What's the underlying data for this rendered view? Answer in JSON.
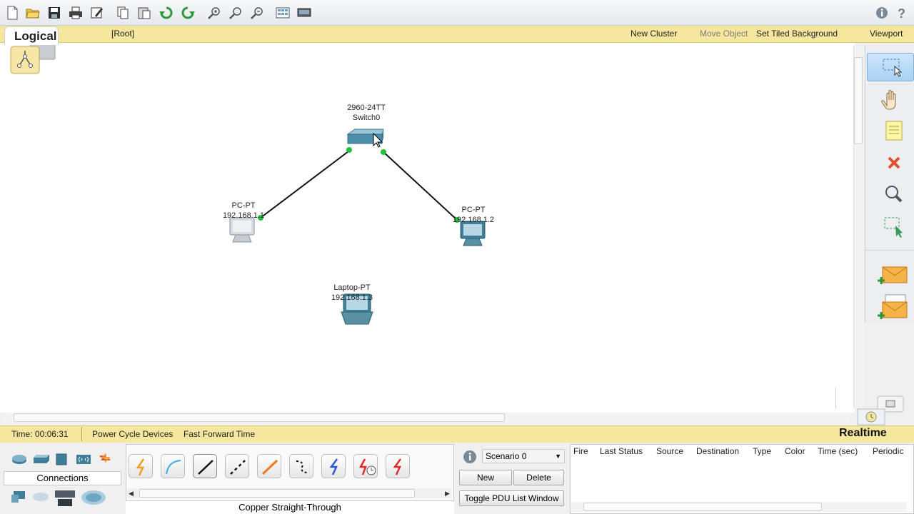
{
  "toolbar": {
    "icons": [
      "new-file-icon",
      "open-folder-icon",
      "save-icon",
      "print-icon",
      "activity-wizard-icon",
      "copy-icon",
      "paste-icon",
      "undo-icon",
      "redo-icon",
      "zoom-in-icon",
      "zoom-reset-icon",
      "zoom-out-icon",
      "palette-icon",
      "custom-device-icon"
    ],
    "help_icons": [
      "info-icon",
      "help-icon"
    ]
  },
  "logical_bar": {
    "tab_label": "Logical",
    "root_label": "[Root]",
    "new_cluster": "New Cluster",
    "move_object": "Move Object",
    "set_tiled_background": "Set Tiled Background",
    "viewport": "Viewport"
  },
  "devices": [
    {
      "name": "switch0",
      "model": "2960-24TT",
      "label": "Switch0"
    },
    {
      "name": "pc0",
      "model": "PC-PT",
      "ip": "192.168.1.1"
    },
    {
      "name": "pc1",
      "model": "PC-PT",
      "ip": "192.168.1.2"
    },
    {
      "name": "laptop0",
      "model": "Laptop-PT",
      "ip": "192.168.1.3"
    }
  ],
  "status": {
    "time": "Time: 00:06:31",
    "power_cycle": "Power Cycle Devices",
    "fast_forward": "Fast Forward Time",
    "mode": "Realtime"
  },
  "bottom": {
    "connections_label": "Connections",
    "selected_cable": "Copper Straight-Through",
    "scenario": "Scenario 0",
    "new_button": "New",
    "delete_button": "Delete",
    "toggle_pdu": "Toggle PDU List Window",
    "pdu_columns": [
      "Fire",
      "Last Status",
      "Source",
      "Destination",
      "Type",
      "Color",
      "Time (sec)",
      "Periodic"
    ]
  },
  "colors": {
    "logical_bar": "#f5e79e",
    "link_up": "#22c33a",
    "palette_delete": "#e0522a"
  }
}
